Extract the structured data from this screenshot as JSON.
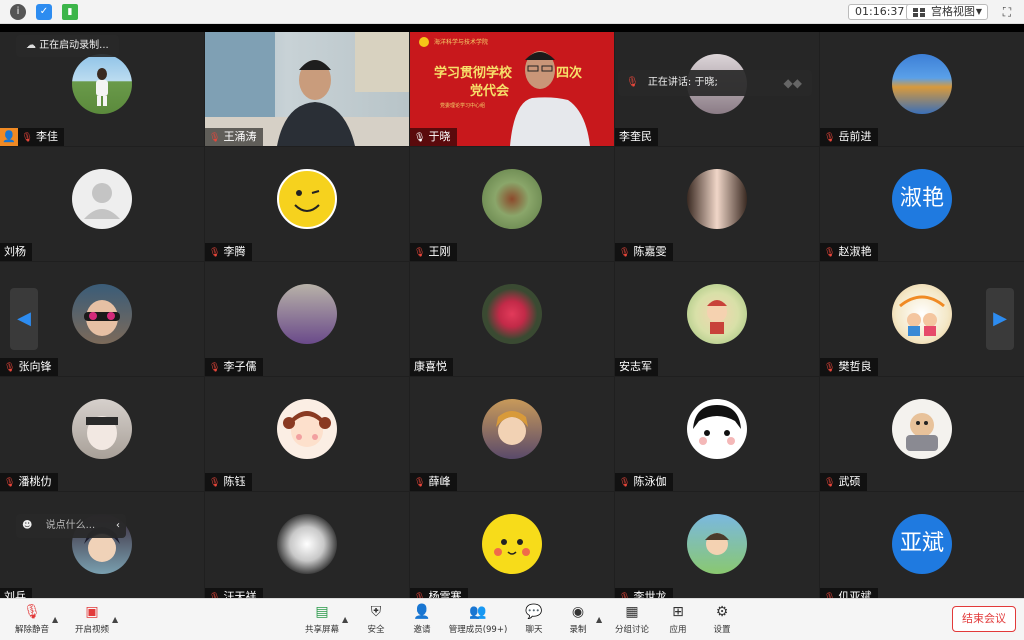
{
  "topbar": {
    "icons": [
      "info-icon",
      "shield-icon",
      "signal-icon"
    ],
    "timer": "01:16:37",
    "view_label": "宫格视图"
  },
  "overlays": {
    "recording": "正在启动录制...",
    "speaking": "正在讲话: 于晓;",
    "chat_placeholder": "说点什么..."
  },
  "red_banner": {
    "school": "海洋科学与技术学院",
    "headline_1": "学习贯彻学校",
    "headline_2": "四次",
    "headline_3": "党代会",
    "subline": "党委理论学习中心组"
  },
  "participants": [
    {
      "name": "李佳",
      "mic": "muted",
      "host": true
    },
    {
      "name": "王涌涛",
      "mic": "muted"
    },
    {
      "name": "于晓",
      "mic": "on",
      "speaking": true
    },
    {
      "name": "李奎民",
      "mic": "none"
    },
    {
      "name": "岳前进",
      "mic": "muted"
    },
    {
      "name": "刘杨",
      "mic": "none"
    },
    {
      "name": "李腾",
      "mic": "muted"
    },
    {
      "name": "王刚",
      "mic": "muted"
    },
    {
      "name": "陈嘉雯",
      "mic": "muted"
    },
    {
      "name": "赵淑艳",
      "mic": "muted",
      "avatar_text": "淑艳"
    },
    {
      "name": "张向锋",
      "mic": "muted"
    },
    {
      "name": "李子儒",
      "mic": "muted"
    },
    {
      "name": "康喜悦",
      "mic": "none"
    },
    {
      "name": "安志军",
      "mic": "none"
    },
    {
      "name": "樊哲良",
      "mic": "muted"
    },
    {
      "name": "潘桃仂",
      "mic": "muted"
    },
    {
      "name": "陈钰",
      "mic": "muted"
    },
    {
      "name": "薛峰",
      "mic": "muted"
    },
    {
      "name": "陈泳伽",
      "mic": "muted"
    },
    {
      "name": "武硕",
      "mic": "muted"
    },
    {
      "name": "刘兵",
      "mic": "none"
    },
    {
      "name": "汪天祥",
      "mic": "muted"
    },
    {
      "name": "杨雪寒",
      "mic": "muted"
    },
    {
      "name": "李世龙",
      "mic": "muted"
    },
    {
      "name": "仉亚斌",
      "mic": "muted",
      "avatar_text": "亚斌"
    }
  ],
  "toolbar": {
    "unmute": "解除静音",
    "start_video": "开启视频",
    "share_screen": "共享屏幕",
    "security": "安全",
    "invite": "邀请",
    "manage_members": "管理成员(99+)",
    "chat": "聊天",
    "record": "录制",
    "breakout": "分组讨论",
    "apps": "应用",
    "settings": "设置",
    "end_meeting": "结束会议"
  },
  "colors": {
    "accent_blue": "#2d8cf0",
    "avatar_blue": "#1f7ae0",
    "end_red": "#e23a3a",
    "speaking_green": "#38c25b"
  }
}
